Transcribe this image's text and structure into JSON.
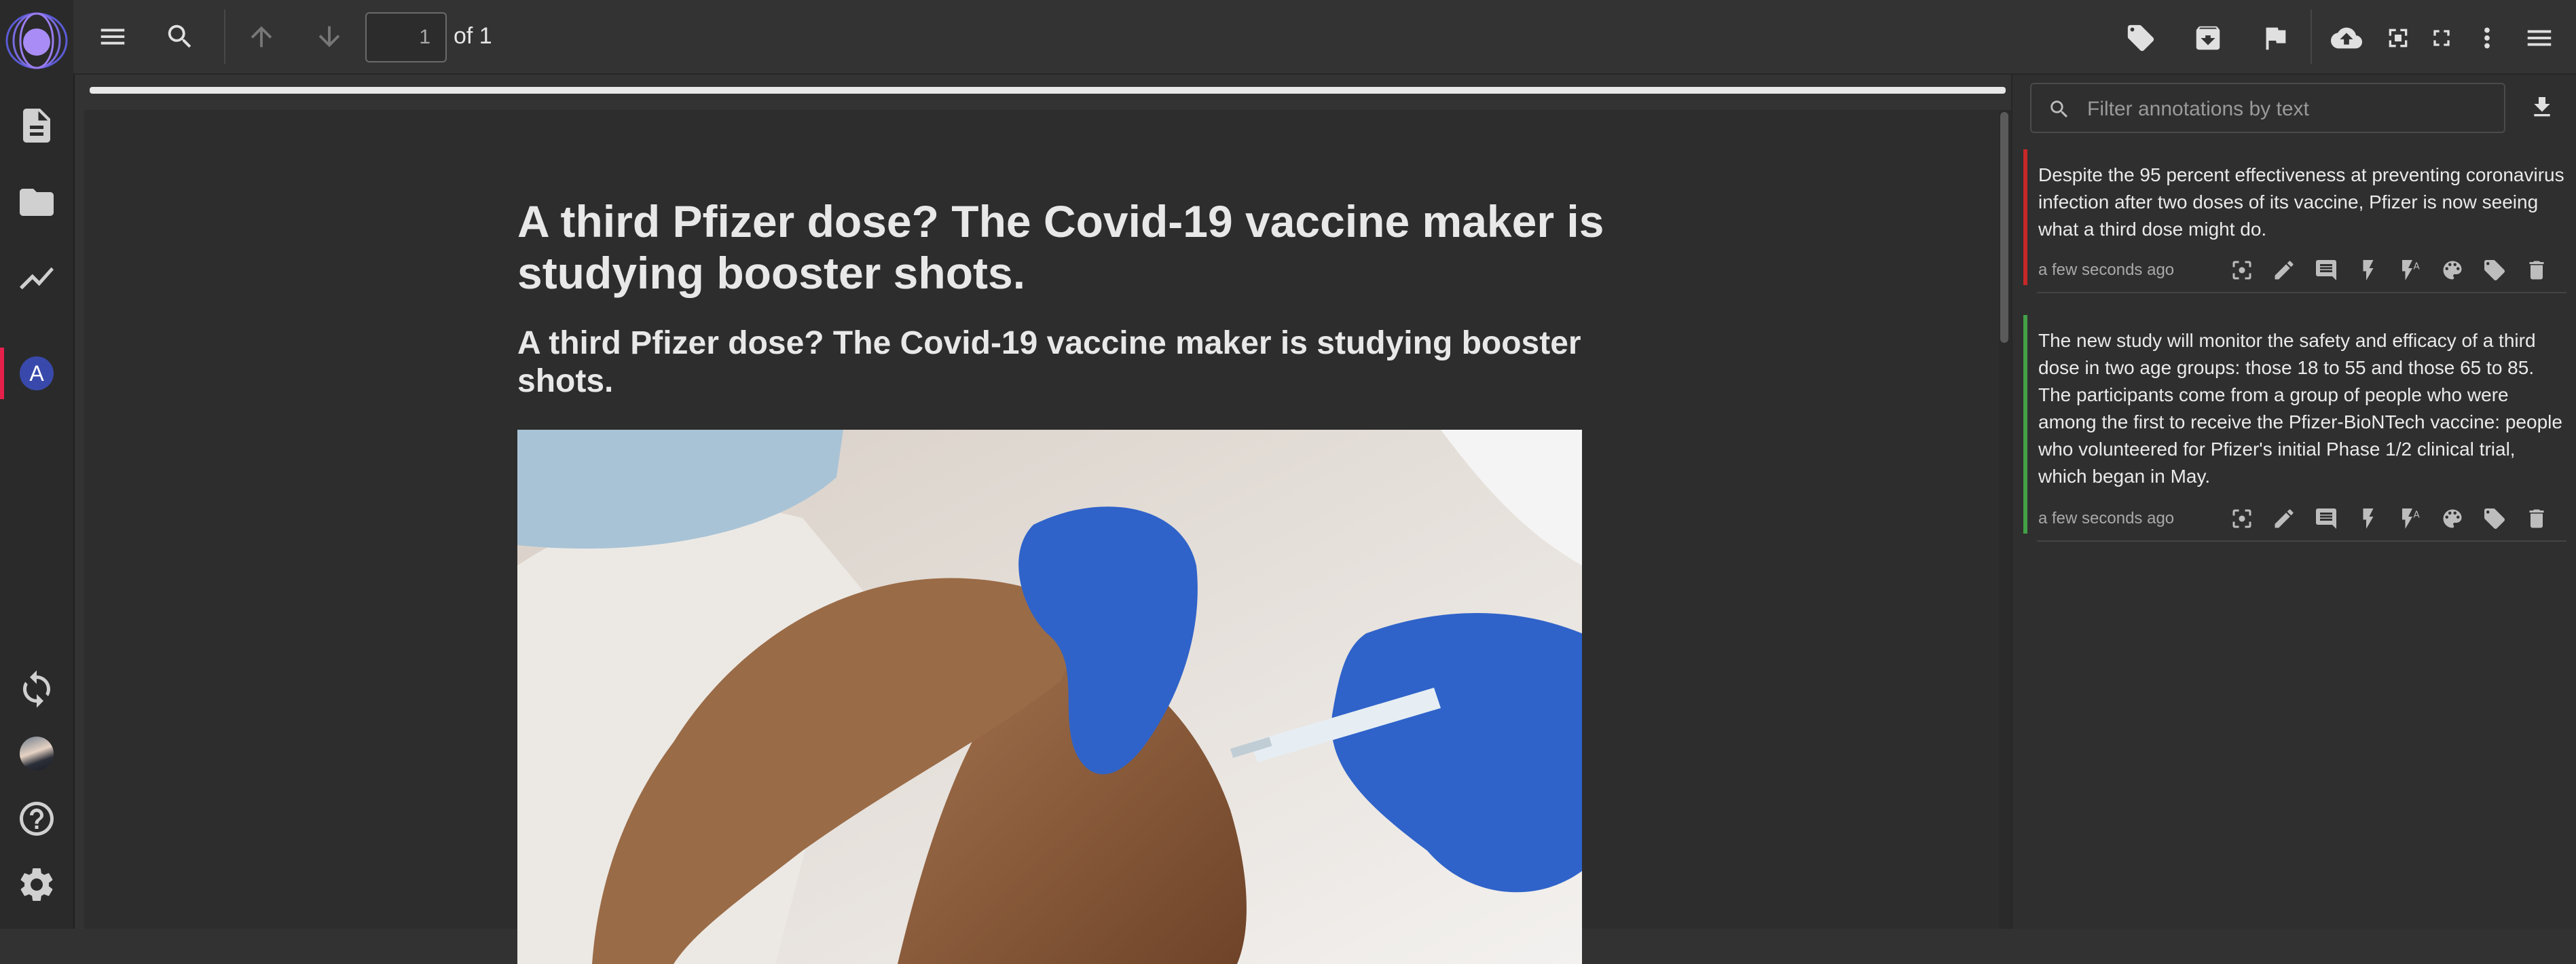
{
  "toolbar": {
    "page_current": "1",
    "page_of": "of 1",
    "left_icons": [
      "menu-icon",
      "search-icon",
      "arrow-up-icon",
      "arrow-down-icon"
    ],
    "right_icons": [
      "tag-icon",
      "archive-icon",
      "flag-icon",
      "cloud-upload-icon",
      "fullscreen-icon",
      "fit-screen-icon",
      "more-vert-icon",
      "menu-icon"
    ]
  },
  "rail": {
    "icons": [
      "document-icon",
      "folder-icon",
      "analytics-icon",
      "sync-icon",
      "help-icon",
      "settings-icon"
    ],
    "active_initial": "A",
    "active_color": "#e5204b",
    "avatar_color": "#3949ab"
  },
  "document": {
    "title": "A third Pfizer dose? The Covid-19 vaccine maker is studying booster shots.",
    "subtitle": "A third Pfizer dose? The Covid-19 vaccine maker is studying booster shots.",
    "image": "vaccination-photo"
  },
  "annotations": {
    "filter_placeholder": "Filter annotations by text",
    "items": [
      {
        "text": "Despite the 95 percent effectiveness at preventing coronavirus infection after two doses of its vaccine, Pfizer is now seeing what a third dose might do.",
        "time": "a few seconds ago",
        "color": "#c62828"
      },
      {
        "text": "The new study will monitor the safety and efficacy of a third dose in two age groups: those 18 to 55 and those 65 to 85. The participants come from a group of people who were among the first to receive the Pfizer-BioNTech vaccine: people who volunteered for Pfizer's initial Phase 1/2 clinical trial, which began in May.",
        "time": "a few seconds ago",
        "color": "#43a047"
      }
    ],
    "action_icons": [
      "focus-icon",
      "edit-icon",
      "comment-icon",
      "lightning-icon",
      "lightning-text-icon",
      "palette-icon",
      "tag-icon",
      "delete-icon"
    ]
  }
}
